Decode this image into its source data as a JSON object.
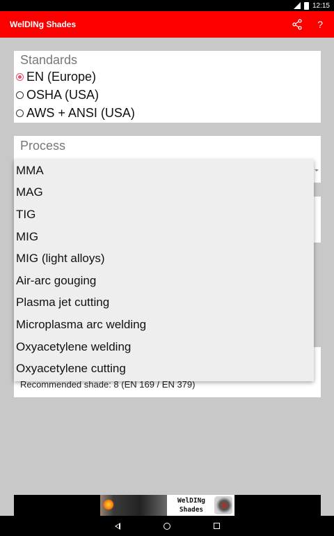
{
  "status_bar": {
    "time": "12:15"
  },
  "app_bar": {
    "title": "WelDINg Shades",
    "share_icon": "share-icon",
    "help_label": "?"
  },
  "standards": {
    "title": "Standards",
    "options": [
      {
        "label": "EN (Europe)",
        "checked": true
      },
      {
        "label": "OSHA (USA)",
        "checked": false
      },
      {
        "label": "AWS + ANSI (USA)",
        "checked": false
      }
    ]
  },
  "process": {
    "title": "Process",
    "dropdown_items": [
      "MMA",
      "MAG",
      "TIG",
      "MIG",
      "MIG (light alloys)",
      "Air-arc gouging",
      "Plasma jet cutting",
      "Microplasma arc welding",
      "Oxyacetylene welding",
      "Oxyacetylene cutting"
    ]
  },
  "result": {
    "text": "Recommended shade: 8 (EN 169 / EN 379)"
  },
  "ad": {
    "line1": "WelDINg",
    "line2": "Shades"
  },
  "colors": {
    "app_bar": "#fc0000",
    "radio_accent": "#e84d6a",
    "background": "#c8c8c8"
  }
}
